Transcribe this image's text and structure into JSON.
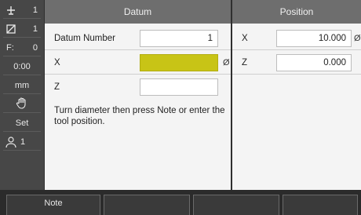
{
  "sidebar": {
    "tool_number": "1",
    "datum_number": "1",
    "feed_label": "F:",
    "feed_value": "0",
    "time": "0:00",
    "units": "mm",
    "set_label": "Set",
    "user_number": "1",
    "icons": [
      "tool-icon",
      "datum-icon",
      "hand-icon",
      "user-icon"
    ]
  },
  "datum_panel": {
    "title": "Datum",
    "rows": {
      "datum_number_label": "Datum Number",
      "datum_number_value": "1",
      "x_label": "X",
      "x_value": "",
      "x_suffix": "Ø",
      "z_label": "Z",
      "z_value": ""
    },
    "help_text": "Turn diameter then press Note or enter the tool position."
  },
  "position_panel": {
    "title": "Position",
    "x_label": "X",
    "x_value": "10.000",
    "x_suffix": "Ø",
    "z_label": "Z",
    "z_value": "0.000"
  },
  "softkeys": {
    "note": "Note",
    "key2": "",
    "key3": "",
    "key4": ""
  },
  "colors": {
    "active_field": "#c8c416",
    "header": "#6e6e6e",
    "sidebar": "#474747"
  }
}
